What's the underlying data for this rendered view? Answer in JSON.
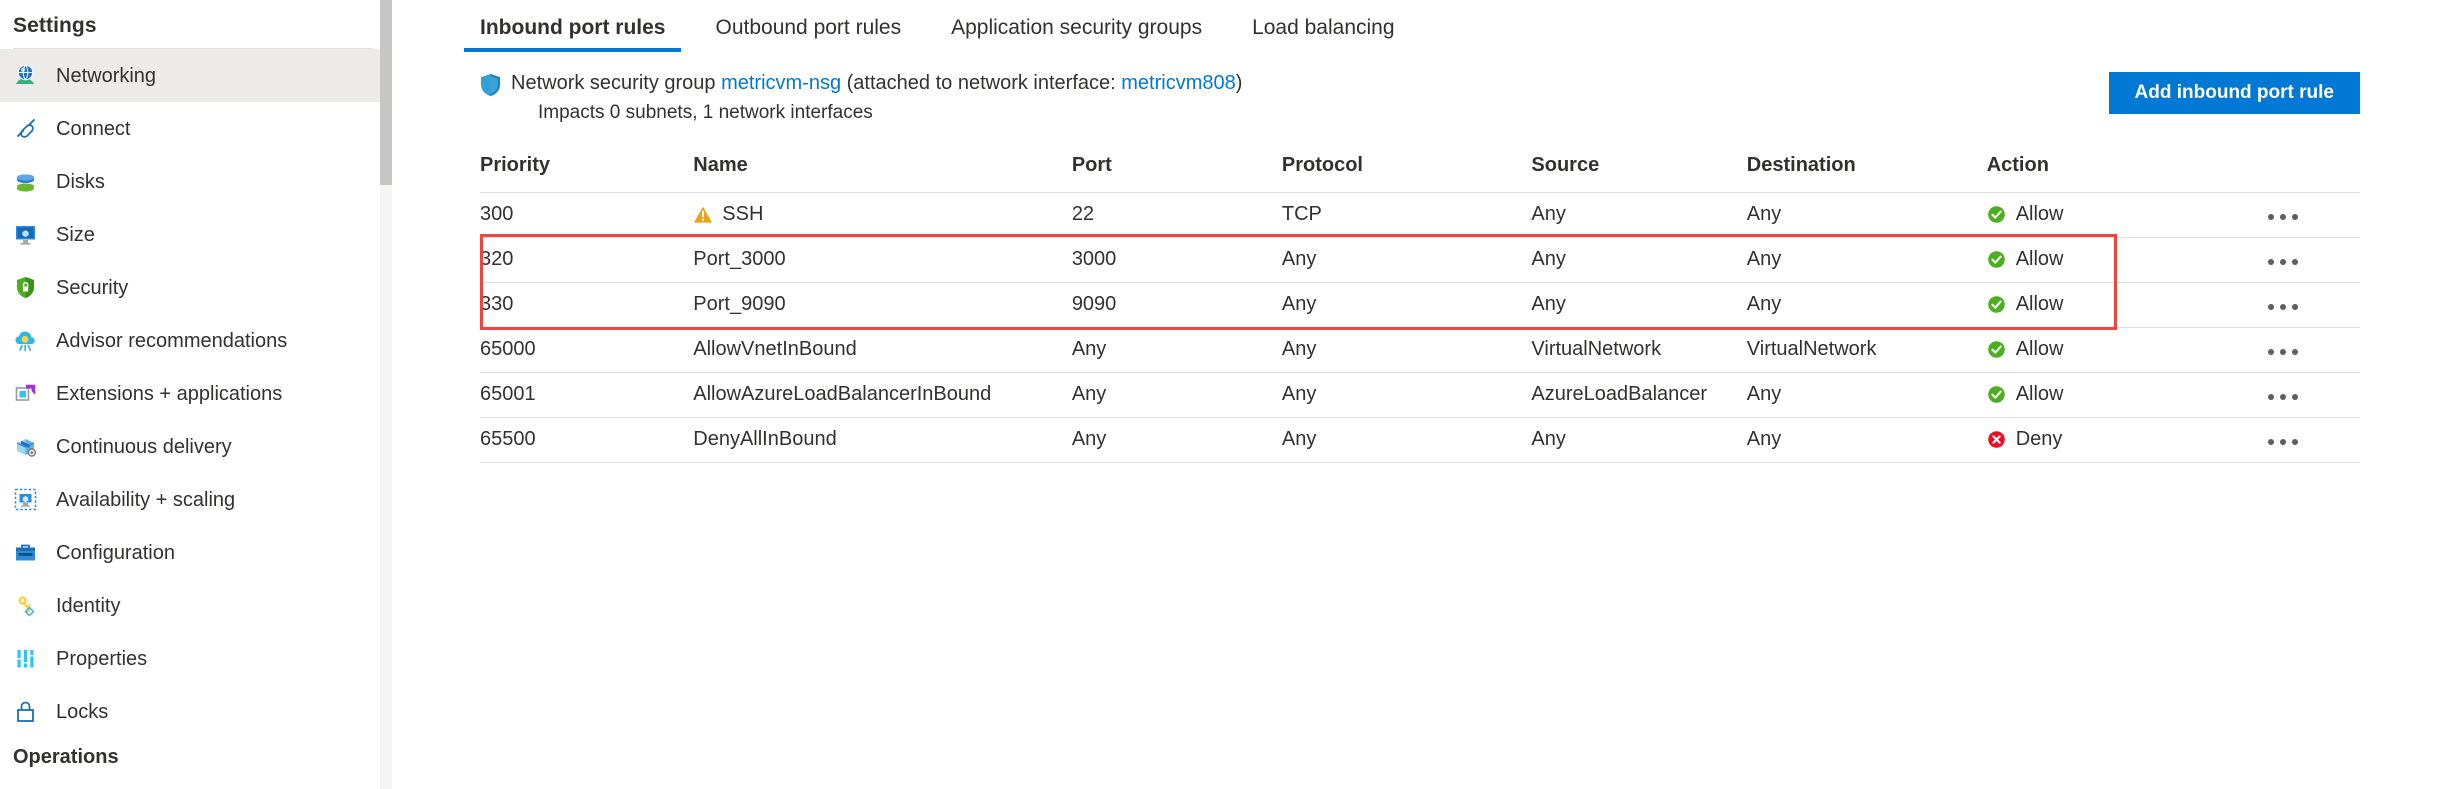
{
  "sidebar": {
    "title": "Settings",
    "items": [
      {
        "label": "Networking",
        "icon": "globe-network-icon",
        "selected": true
      },
      {
        "label": "Connect",
        "icon": "connect-plug-icon",
        "selected": false
      },
      {
        "label": "Disks",
        "icon": "disks-icon",
        "selected": false
      },
      {
        "label": "Size",
        "icon": "size-monitor-icon",
        "selected": false
      },
      {
        "label": "Security",
        "icon": "security-shield-icon",
        "selected": false
      },
      {
        "label": "Advisor recommendations",
        "icon": "advisor-cloud-icon",
        "selected": false
      },
      {
        "label": "Extensions + applications",
        "icon": "extensions-icon",
        "selected": false
      },
      {
        "label": "Continuous delivery",
        "icon": "continuous-delivery-icon",
        "selected": false
      },
      {
        "label": "Availability + scaling",
        "icon": "availability-scaling-icon",
        "selected": false
      },
      {
        "label": "Configuration",
        "icon": "configuration-toolbox-icon",
        "selected": false
      },
      {
        "label": "Identity",
        "icon": "identity-key-icon",
        "selected": false
      },
      {
        "label": "Properties",
        "icon": "properties-bars-icon",
        "selected": false
      },
      {
        "label": "Locks",
        "icon": "locks-padlock-icon",
        "selected": false
      }
    ],
    "section_operations": "Operations"
  },
  "tabs": [
    {
      "label": "Inbound port rules",
      "active": true
    },
    {
      "label": "Outbound port rules",
      "active": false
    },
    {
      "label": "Application security groups",
      "active": false
    },
    {
      "label": "Load balancing",
      "active": false
    }
  ],
  "nsg": {
    "icon": "shield-icon",
    "prefix": "Network security group ",
    "name_link": "metricvm-nsg",
    "middle": " (attached to network interface: ",
    "nic_link": "metricvm808",
    "suffix": ")",
    "impacts": "Impacts 0 subnets, 1 network interfaces"
  },
  "actions": {
    "add_inbound_port_rule": "Add inbound port rule"
  },
  "table": {
    "columns": [
      "Priority",
      "Name",
      "Port",
      "Protocol",
      "Source",
      "Destination",
      "Action"
    ],
    "rows": [
      {
        "priority": "300",
        "name": "SSH",
        "name_icon": "warning-triangle-icon",
        "port": "22",
        "protocol": "TCP",
        "source": "Any",
        "destination": "Any",
        "action": "Allow",
        "action_icon": "allow-check-icon",
        "highlighted": false,
        "menu_icon": "more-options-icon"
      },
      {
        "priority": "320",
        "name": "Port_3000",
        "name_icon": "",
        "port": "3000",
        "protocol": "Any",
        "source": "Any",
        "destination": "Any",
        "action": "Allow",
        "action_icon": "allow-check-icon",
        "highlighted": true,
        "menu_icon": "more-options-icon"
      },
      {
        "priority": "330",
        "name": "Port_9090",
        "name_icon": "",
        "port": "9090",
        "protocol": "Any",
        "source": "Any",
        "destination": "Any",
        "action": "Allow",
        "action_icon": "allow-check-icon",
        "highlighted": true,
        "menu_icon": "more-options-icon"
      },
      {
        "priority": "65000",
        "name": "AllowVnetInBound",
        "name_icon": "",
        "port": "Any",
        "protocol": "Any",
        "source": "VirtualNetwork",
        "destination": "VirtualNetwork",
        "action": "Allow",
        "action_icon": "allow-check-icon",
        "highlighted": false,
        "menu_icon": "more-options-icon"
      },
      {
        "priority": "65001",
        "name": "AllowAzureLoadBalancerInBound",
        "name_icon": "",
        "port": "Any",
        "protocol": "Any",
        "source": "AzureLoadBalancer",
        "destination": "Any",
        "action": "Allow",
        "action_icon": "allow-check-icon",
        "highlighted": false,
        "menu_icon": "more-options-icon"
      },
      {
        "priority": "65500",
        "name": "DenyAllInBound",
        "name_icon": "",
        "port": "Any",
        "protocol": "Any",
        "source": "Any",
        "destination": "Any",
        "action": "Deny",
        "action_icon": "deny-x-icon",
        "highlighted": false,
        "menu_icon": "more-options-icon"
      }
    ]
  },
  "colors": {
    "accent": "#0078d4",
    "allow": "#4caf20",
    "deny": "#e81123",
    "warning": "#e8a317",
    "highlight_box": "#f0453f",
    "selected_nav": "#edebe9"
  }
}
